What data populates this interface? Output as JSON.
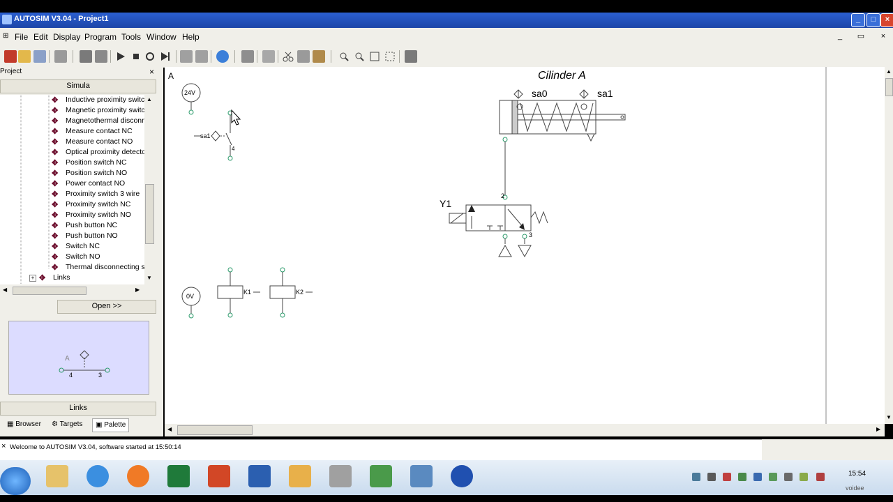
{
  "window": {
    "title": "AUTOSIM  V3.04 - Project1"
  },
  "menu": [
    "File",
    "Edit",
    "Display",
    "Program",
    "Tools",
    "Window",
    "Help"
  ],
  "project": {
    "header": "Project",
    "close": "×",
    "group_tab": "Simula",
    "items": [
      "Inductive proximity switch",
      "Magnetic proximity switch",
      "Magnetothermal disconnector",
      "Measure contact NC",
      "Measure contact NO",
      "Optical proximity detector",
      "Position switch NC",
      "Position switch NO",
      "Power contact NO",
      "Proximity switch 3 wire",
      "Proximity switch NC",
      "Proximity switch NO",
      "Push button NC",
      "Push button NO",
      "Switch NC",
      "Switch NO",
      "Thermal disconnecting switch"
    ],
    "folder": "Links",
    "open_button": "Open >>",
    "preview_labels": {
      "a": "A",
      "p4": "4",
      "p3": "3"
    },
    "links_tab": "Links",
    "bottom_tabs": [
      "Browser",
      "Targets",
      "Palette"
    ]
  },
  "canvas": {
    "corner_label": "A",
    "cylinder_title": "Cilinder A",
    "sensor_sa0": "sa0",
    "sensor_sa1": "sa1",
    "valve_label": "Y1",
    "port2": "2",
    "port3": "3",
    "supply_24v": "24V",
    "supply_0v": "0V",
    "switch_label": "sa1",
    "switch_port4": "4",
    "coil_k1": "K1",
    "coil_k2": "K2"
  },
  "status": {
    "message": "Welcome to AUTOSIM  V3.04, software started at 15:50:14"
  },
  "taskbar": {
    "clock": "15:54",
    "clock_sub": "voidee"
  },
  "colors": {
    "titlebar": "#1f4fb8",
    "canvas": "#ffffff",
    "preview": "#dcdcff",
    "node": "#2a9a6a"
  }
}
